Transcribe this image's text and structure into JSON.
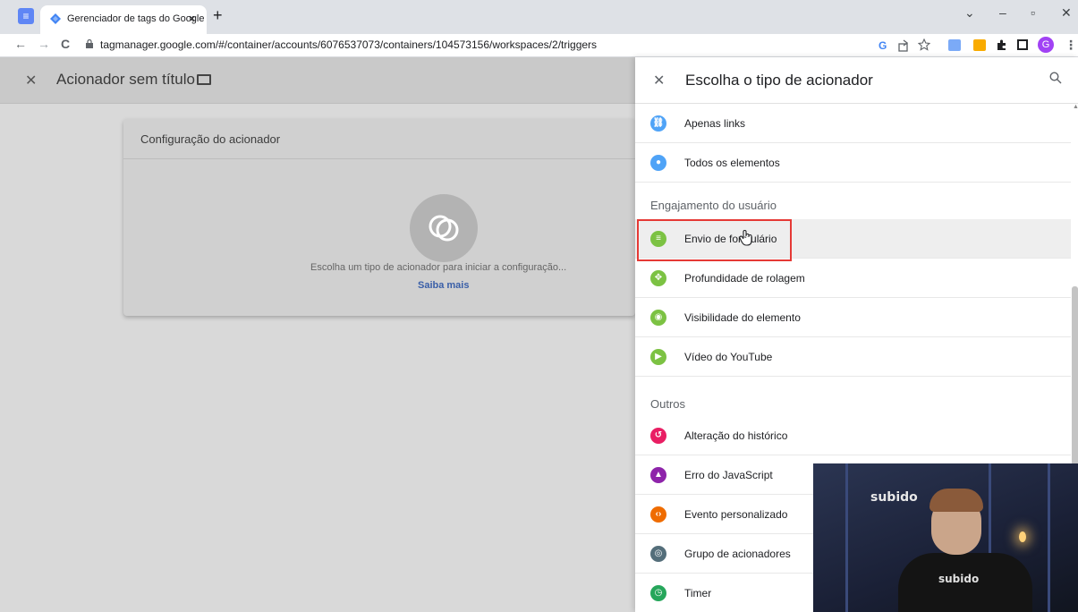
{
  "browser": {
    "tab_title": "Gerenciador de tags do Google",
    "tab_close": "×",
    "new_tab": "+",
    "url": "tagmanager.google.com/#/container/accounts/6076537073/containers/104573156/workspaces/2/triggers",
    "nav": {
      "back": "←",
      "forward": "→",
      "reload": "C"
    },
    "window_controls": {
      "dropdown": "⌄",
      "minimize": "–",
      "maximize": "▫",
      "close": "✕"
    },
    "profile_initial": "G"
  },
  "editor": {
    "title": "Acionador sem título",
    "close_icon": "close-icon",
    "card_title": "Configuração do acionador",
    "prompt": "Escolha um tipo de acionador para iniciar a configuração...",
    "learn_more": "Saiba mais"
  },
  "panel": {
    "title": "Escolha o tipo de acionador",
    "items_top": [
      {
        "label": "Apenas links",
        "color": "#4fa3f7",
        "icon": "link-icon"
      },
      {
        "label": "Todos os elementos",
        "color": "#4fa3f7",
        "icon": "mouse-icon"
      }
    ],
    "section_engagement": "Engajamento do usuário",
    "items_engagement": [
      {
        "label": "Envio de formulário",
        "color": "#7cc243",
        "icon": "form-icon"
      },
      {
        "label": "Profundidade de rolagem",
        "color": "#7cc243",
        "icon": "scroll-icon"
      },
      {
        "label": "Visibilidade do elemento",
        "color": "#7cc243",
        "icon": "eye-icon"
      },
      {
        "label": "Vídeo do YouTube",
        "color": "#7cc243",
        "icon": "play-icon"
      }
    ],
    "section_other": "Outros",
    "items_other": [
      {
        "label": "Alteração do histórico",
        "color": "#e91e63",
        "icon": "history-icon"
      },
      {
        "label": "Erro do JavaScript",
        "color": "#8e24aa",
        "icon": "warning-icon"
      },
      {
        "label": "Evento personalizado",
        "color": "#ef6c00",
        "icon": "code-icon"
      },
      {
        "label": "Grupo de acionadores",
        "color": "#546e7a",
        "icon": "group-icon"
      },
      {
        "label": "Timer",
        "color": "#26a65b",
        "icon": "timer-icon"
      }
    ]
  },
  "webcam": {
    "sign_text": "subido",
    "shirt_text": "subido"
  }
}
